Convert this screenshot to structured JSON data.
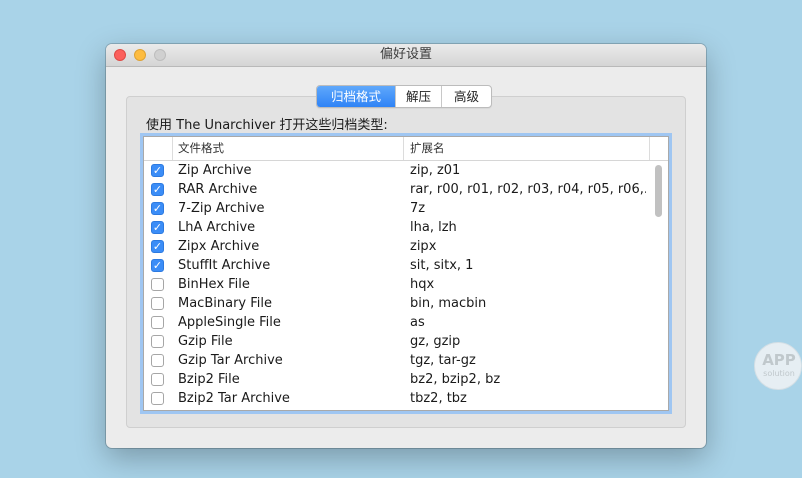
{
  "window": {
    "title": "偏好设置",
    "traffic_lights": [
      "close",
      "minimize",
      "zoom"
    ]
  },
  "tabs": [
    {
      "label": "归档格式",
      "active": true
    },
    {
      "label": "解压",
      "active": false
    },
    {
      "label": "高级",
      "active": false
    }
  ],
  "heading": "使用 The Unarchiver 打开这些归档类型:",
  "table": {
    "columns": [
      "",
      "文件格式",
      "扩展名"
    ],
    "rows": [
      {
        "checked": true,
        "name": "Zip Archive",
        "ext": "zip, z01"
      },
      {
        "checked": true,
        "name": "RAR Archive",
        "ext": "rar, r00, r01, r02, r03, r04, r05, r06,..."
      },
      {
        "checked": true,
        "name": "7-Zip Archive",
        "ext": "7z"
      },
      {
        "checked": true,
        "name": "LhA Archive",
        "ext": "lha, lzh"
      },
      {
        "checked": true,
        "name": "Zipx Archive",
        "ext": "zipx"
      },
      {
        "checked": true,
        "name": "StuffIt Archive",
        "ext": "sit, sitx, 1"
      },
      {
        "checked": false,
        "name": "BinHex File",
        "ext": "hqx"
      },
      {
        "checked": false,
        "name": "MacBinary File",
        "ext": "bin, macbin"
      },
      {
        "checked": false,
        "name": "AppleSingle File",
        "ext": "as"
      },
      {
        "checked": false,
        "name": "Gzip File",
        "ext": "gz, gzip"
      },
      {
        "checked": false,
        "name": "Gzip Tar Archive",
        "ext": "tgz, tar-gz"
      },
      {
        "checked": false,
        "name": "Bzip2 File",
        "ext": "bz2, bzip2, bz"
      },
      {
        "checked": false,
        "name": "Bzip2 Tar Archive",
        "ext": "tbz2, tbz"
      }
    ]
  },
  "watermark": {
    "line1": "APP",
    "line2": "solution"
  },
  "colors": {
    "accent": "#3b8df7",
    "desktop": "#a9d3e8",
    "window_bg": "#ececec"
  }
}
